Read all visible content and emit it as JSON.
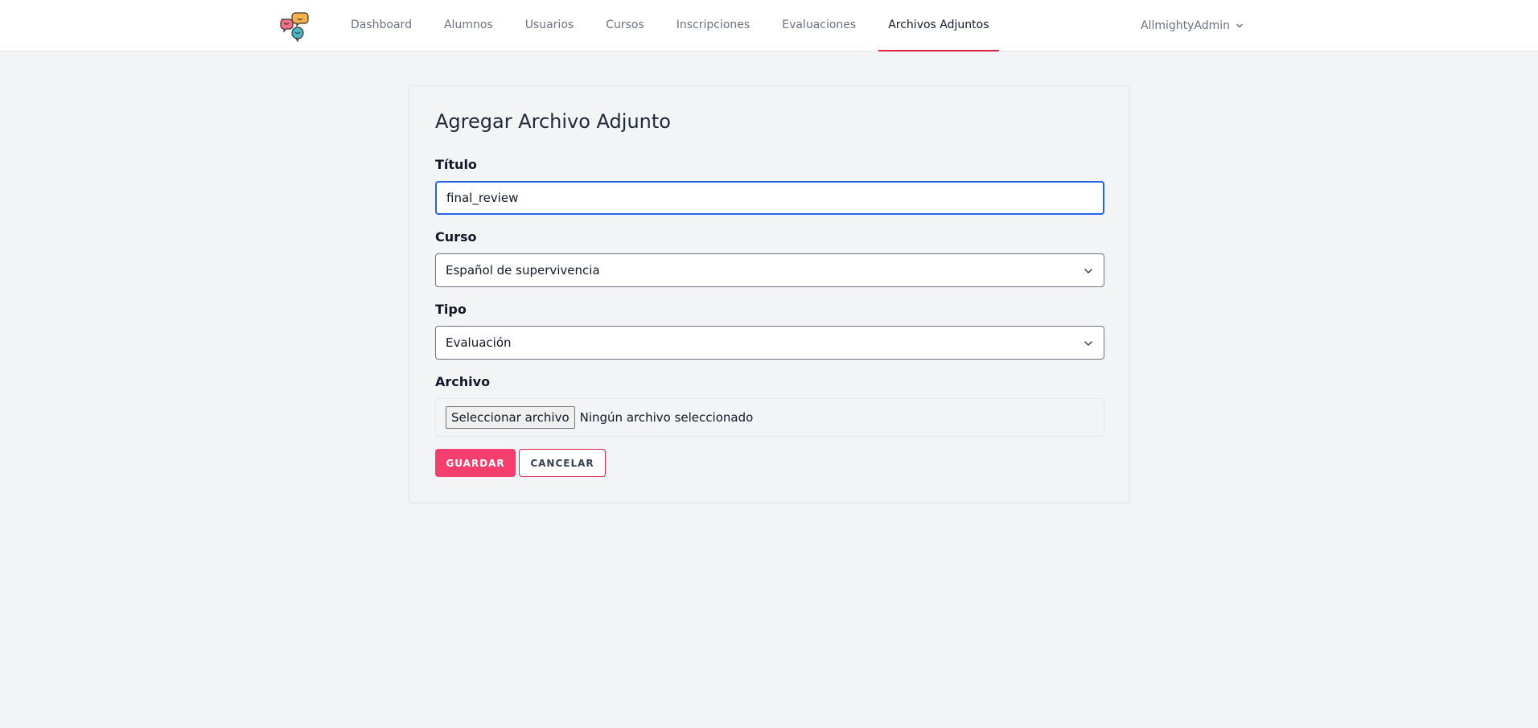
{
  "nav": {
    "items": [
      {
        "label": "Dashboard"
      },
      {
        "label": "Alumnos"
      },
      {
        "label": "Usuarios"
      },
      {
        "label": "Cursos"
      },
      {
        "label": "Inscripciones"
      },
      {
        "label": "Evaluaciones"
      },
      {
        "label": "Archivos Adjuntos",
        "active": true
      }
    ],
    "user": "AllmightyAdmin",
    "logo_icon": "chat-bubbles-icon"
  },
  "form": {
    "title": "Agregar Archivo Adjunto",
    "titulo": {
      "label": "Título",
      "value": "final_review"
    },
    "curso": {
      "label": "Curso",
      "value": "Español de supervivencia"
    },
    "tipo": {
      "label": "Tipo",
      "value": "Evaluación"
    },
    "archivo": {
      "label": "Archivo",
      "button": "Seleccionar archivo",
      "status": "Ningún archivo seleccionado"
    },
    "save": "GUARDAR",
    "cancel": "CANCELAR"
  },
  "colors": {
    "accent": "#f43f6e",
    "focus": "#2563eb",
    "active_underline": "#e11d48"
  }
}
